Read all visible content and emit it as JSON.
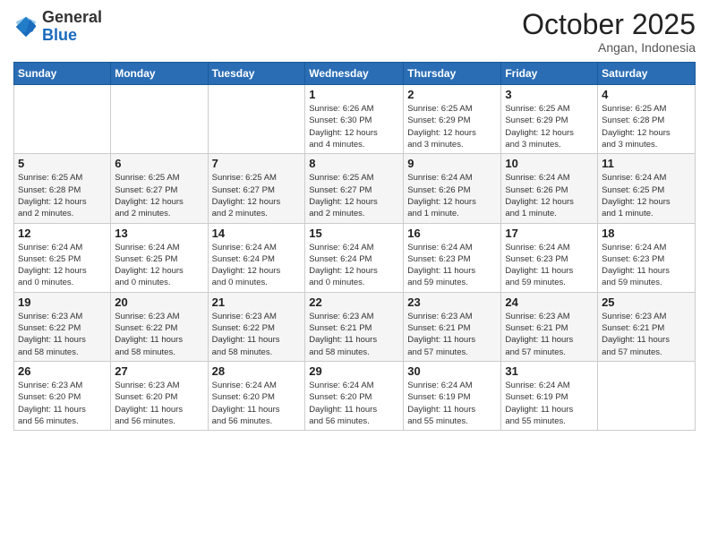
{
  "header": {
    "logo": {
      "general": "General",
      "blue": "Blue"
    },
    "title": "October 2025",
    "location": "Angan, Indonesia"
  },
  "weekdays": [
    "Sunday",
    "Monday",
    "Tuesday",
    "Wednesday",
    "Thursday",
    "Friday",
    "Saturday"
  ],
  "weeks": [
    [
      {
        "day": "",
        "info": ""
      },
      {
        "day": "",
        "info": ""
      },
      {
        "day": "",
        "info": ""
      },
      {
        "day": "1",
        "info": "Sunrise: 6:26 AM\nSunset: 6:30 PM\nDaylight: 12 hours\nand 4 minutes."
      },
      {
        "day": "2",
        "info": "Sunrise: 6:25 AM\nSunset: 6:29 PM\nDaylight: 12 hours\nand 3 minutes."
      },
      {
        "day": "3",
        "info": "Sunrise: 6:25 AM\nSunset: 6:29 PM\nDaylight: 12 hours\nand 3 minutes."
      },
      {
        "day": "4",
        "info": "Sunrise: 6:25 AM\nSunset: 6:28 PM\nDaylight: 12 hours\nand 3 minutes."
      }
    ],
    [
      {
        "day": "5",
        "info": "Sunrise: 6:25 AM\nSunset: 6:28 PM\nDaylight: 12 hours\nand 2 minutes."
      },
      {
        "day": "6",
        "info": "Sunrise: 6:25 AM\nSunset: 6:27 PM\nDaylight: 12 hours\nand 2 minutes."
      },
      {
        "day": "7",
        "info": "Sunrise: 6:25 AM\nSunset: 6:27 PM\nDaylight: 12 hours\nand 2 minutes."
      },
      {
        "day": "8",
        "info": "Sunrise: 6:25 AM\nSunset: 6:27 PM\nDaylight: 12 hours\nand 2 minutes."
      },
      {
        "day": "9",
        "info": "Sunrise: 6:24 AM\nSunset: 6:26 PM\nDaylight: 12 hours\nand 1 minute."
      },
      {
        "day": "10",
        "info": "Sunrise: 6:24 AM\nSunset: 6:26 PM\nDaylight: 12 hours\nand 1 minute."
      },
      {
        "day": "11",
        "info": "Sunrise: 6:24 AM\nSunset: 6:25 PM\nDaylight: 12 hours\nand 1 minute."
      }
    ],
    [
      {
        "day": "12",
        "info": "Sunrise: 6:24 AM\nSunset: 6:25 PM\nDaylight: 12 hours\nand 0 minutes."
      },
      {
        "day": "13",
        "info": "Sunrise: 6:24 AM\nSunset: 6:25 PM\nDaylight: 12 hours\nand 0 minutes."
      },
      {
        "day": "14",
        "info": "Sunrise: 6:24 AM\nSunset: 6:24 PM\nDaylight: 12 hours\nand 0 minutes."
      },
      {
        "day": "15",
        "info": "Sunrise: 6:24 AM\nSunset: 6:24 PM\nDaylight: 12 hours\nand 0 minutes."
      },
      {
        "day": "16",
        "info": "Sunrise: 6:24 AM\nSunset: 6:23 PM\nDaylight: 11 hours\nand 59 minutes."
      },
      {
        "day": "17",
        "info": "Sunrise: 6:24 AM\nSunset: 6:23 PM\nDaylight: 11 hours\nand 59 minutes."
      },
      {
        "day": "18",
        "info": "Sunrise: 6:24 AM\nSunset: 6:23 PM\nDaylight: 11 hours\nand 59 minutes."
      }
    ],
    [
      {
        "day": "19",
        "info": "Sunrise: 6:23 AM\nSunset: 6:22 PM\nDaylight: 11 hours\nand 58 minutes."
      },
      {
        "day": "20",
        "info": "Sunrise: 6:23 AM\nSunset: 6:22 PM\nDaylight: 11 hours\nand 58 minutes."
      },
      {
        "day": "21",
        "info": "Sunrise: 6:23 AM\nSunset: 6:22 PM\nDaylight: 11 hours\nand 58 minutes."
      },
      {
        "day": "22",
        "info": "Sunrise: 6:23 AM\nSunset: 6:21 PM\nDaylight: 11 hours\nand 58 minutes."
      },
      {
        "day": "23",
        "info": "Sunrise: 6:23 AM\nSunset: 6:21 PM\nDaylight: 11 hours\nand 57 minutes."
      },
      {
        "day": "24",
        "info": "Sunrise: 6:23 AM\nSunset: 6:21 PM\nDaylight: 11 hours\nand 57 minutes."
      },
      {
        "day": "25",
        "info": "Sunrise: 6:23 AM\nSunset: 6:21 PM\nDaylight: 11 hours\nand 57 minutes."
      }
    ],
    [
      {
        "day": "26",
        "info": "Sunrise: 6:23 AM\nSunset: 6:20 PM\nDaylight: 11 hours\nand 56 minutes."
      },
      {
        "day": "27",
        "info": "Sunrise: 6:23 AM\nSunset: 6:20 PM\nDaylight: 11 hours\nand 56 minutes."
      },
      {
        "day": "28",
        "info": "Sunrise: 6:24 AM\nSunset: 6:20 PM\nDaylight: 11 hours\nand 56 minutes."
      },
      {
        "day": "29",
        "info": "Sunrise: 6:24 AM\nSunset: 6:20 PM\nDaylight: 11 hours\nand 56 minutes."
      },
      {
        "day": "30",
        "info": "Sunrise: 6:24 AM\nSunset: 6:19 PM\nDaylight: 11 hours\nand 55 minutes."
      },
      {
        "day": "31",
        "info": "Sunrise: 6:24 AM\nSunset: 6:19 PM\nDaylight: 11 hours\nand 55 minutes."
      },
      {
        "day": "",
        "info": ""
      }
    ]
  ]
}
